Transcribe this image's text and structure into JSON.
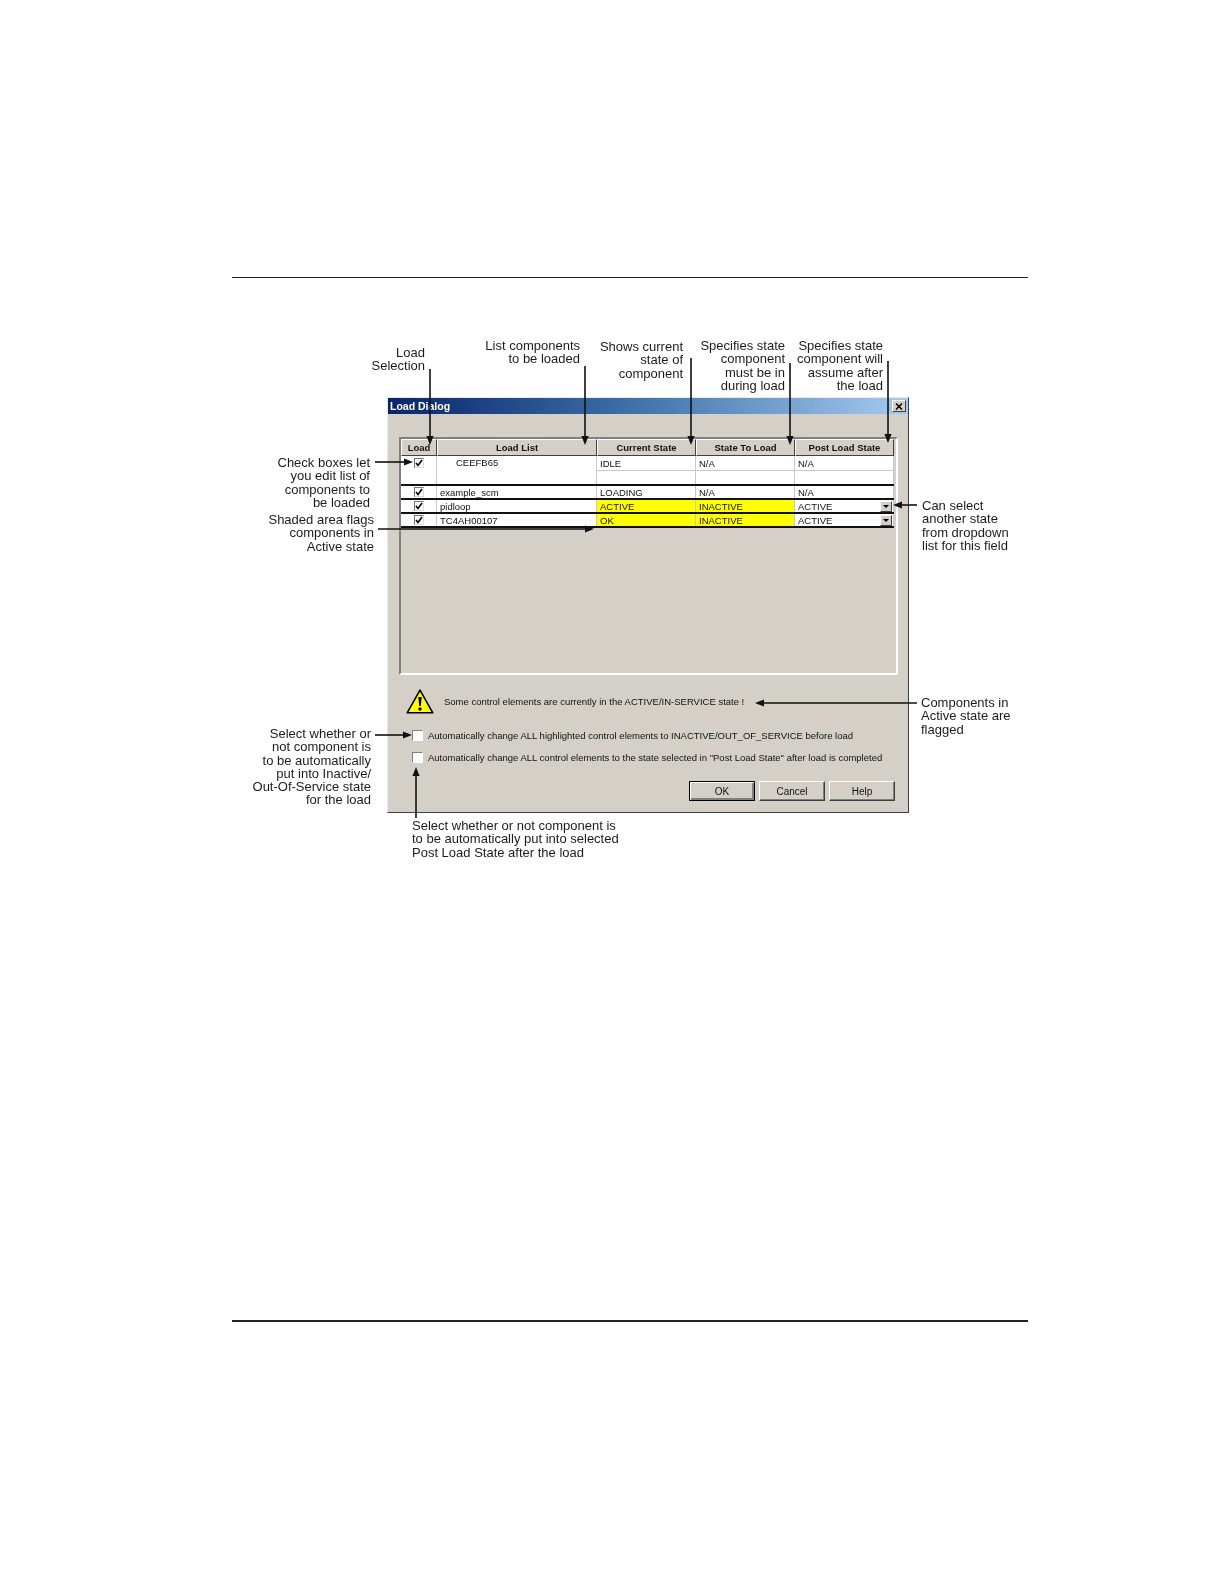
{
  "callouts_top": [
    {
      "text": "Load\nSelection"
    },
    {
      "text": "List components\nto be loaded"
    },
    {
      "text": "Shows current\nstate of\ncomponent"
    },
    {
      "text": "Specifies state\ncomponent\nmust be in\nduring load"
    },
    {
      "text": "Specifies state\ncomponent will\nassume after\nthe load"
    }
  ],
  "callouts_left": [
    {
      "text": "Check boxes let\nyou edit list of\ncomponents to\nbe loaded"
    },
    {
      "text": "Shaded area flags\ncomponents in\nActive state"
    },
    {
      "text": "Select whether or\nnot component is\nto be automatically\nput into Inactive/\nOut-Of-Service state\nfor the load"
    }
  ],
  "dialog": {
    "title": "Load Dialog",
    "table": {
      "columns": [
        "Load",
        "Load List",
        "Current State",
        "State To Load",
        "Post Load State"
      ],
      "rows": [
        {
          "kind": "group",
          "checked": true,
          "name": "CEEFB65",
          "current_state": "IDLE",
          "state_to_load": "N/A",
          "post_load_state": "N/A",
          "highlighted": false,
          "dropdown": false
        },
        {
          "kind": "item",
          "checked": true,
          "name": "example_scm",
          "current_state": "LOADING",
          "state_to_load": "N/A",
          "post_load_state": "N/A",
          "highlighted": false,
          "dropdown": false
        },
        {
          "kind": "item",
          "checked": true,
          "name": "pidloop",
          "current_state": "ACTIVE",
          "state_to_load": "INACTIVE",
          "post_load_state": "ACTIVE",
          "highlighted": true,
          "dropdown": true
        },
        {
          "kind": "item",
          "checked": true,
          "name": "TC4AH00107",
          "current_state": "OK",
          "state_to_load": "INACTIVE",
          "post_load_state": "ACTIVE",
          "highlighted": true,
          "dropdown": true
        }
      ]
    },
    "warning": {
      "text": "Some control elements are currently in the ACTIVE/IN-SERVICE state !"
    },
    "options": [
      {
        "label": "Automatically change ALL highlighted control elements to INACTIVE/OUT_OF_SERVICE before load",
        "checked": false
      },
      {
        "label": "Automatically change ALL control elements to the state selected in \"Post Load State\" after load is completed",
        "checked": false
      }
    ],
    "buttons": [
      {
        "label": "OK",
        "default": true
      },
      {
        "label": "Cancel",
        "default": false
      },
      {
        "label": "Help",
        "default": false
      }
    ]
  },
  "callouts_right": [
    {
      "text": "Can select\nanother state\nfrom dropdown\nlist for this field"
    },
    {
      "text": "Components in\nActive state are\nflagged"
    }
  ],
  "callouts_bottom": [
    {
      "text": "Select whether or not component is\nto be automatically put into selected\nPost Load State after the load"
    }
  ]
}
